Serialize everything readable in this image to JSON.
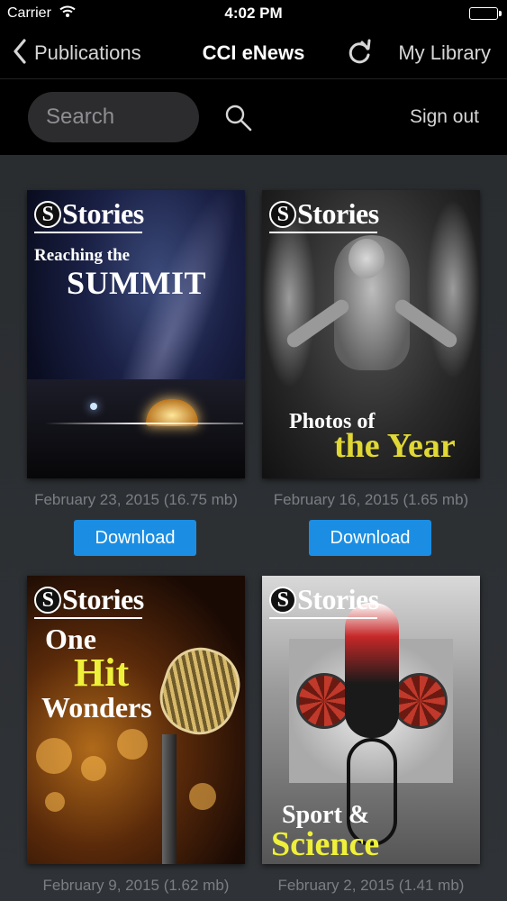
{
  "status_bar": {
    "carrier": "Carrier",
    "time": "4:02 PM"
  },
  "nav": {
    "back_label": "Publications",
    "title": "CCI eNews",
    "library_label": "My Library"
  },
  "search": {
    "placeholder": "Search",
    "value": "",
    "signout_label": "Sign out"
  },
  "publications": [
    {
      "brand": "Stories",
      "title_lines": [
        "Reaching the",
        "SUMMIT"
      ],
      "meta": "February 23, 2015 (16.75 mb)",
      "action": "Download"
    },
    {
      "brand": "Stories",
      "title_lines": [
        "Photos of",
        "the Year"
      ],
      "meta": "February 16, 2015 (1.65 mb)",
      "action": "Download"
    },
    {
      "brand": "Stories",
      "title_lines": [
        "One",
        "Hit",
        "Wonders"
      ],
      "meta": "February 9, 2015 (1.62 mb)"
    },
    {
      "brand": "Stories",
      "title_lines": [
        "Sport &",
        "Science"
      ],
      "meta": "February 2, 2015 (1.41 mb)"
    }
  ],
  "colors": {
    "accent": "#1b8ee3",
    "background": "#2b2e31",
    "bar": "#000000",
    "meta_text": "#7b7f84"
  }
}
